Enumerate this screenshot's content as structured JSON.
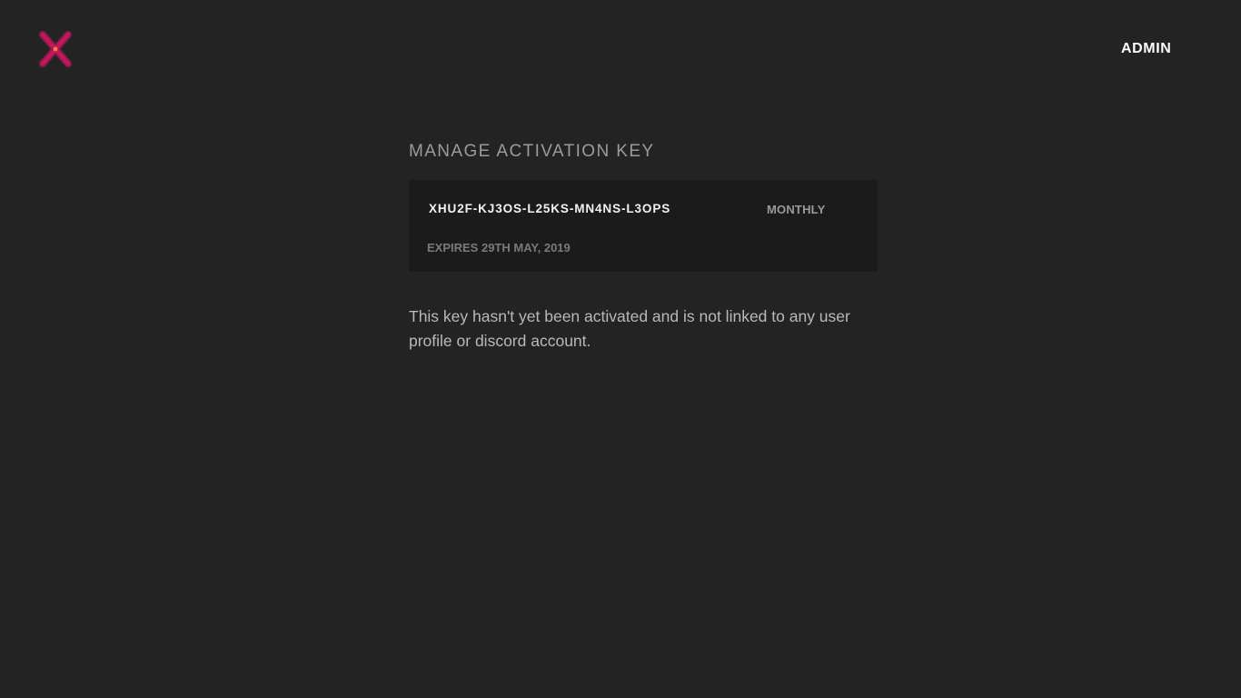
{
  "header": {
    "logo_icon": "x-logo-icon",
    "admin_label": "ADMIN"
  },
  "main": {
    "title": "MANAGE ACTIVATION KEY",
    "key": {
      "value": "XHU2F-KJ3OS-L25KS-MN4NS-L3OPS",
      "plan": "MONTHLY",
      "expires": "EXPIRES 29TH MAY, 2019"
    },
    "status_message": "This key hasn't yet been activated and is not linked to any user profile or discord account."
  },
  "colors": {
    "background": "#232323",
    "card_background": "#1b1b1b",
    "brand_accent": "#c2185b",
    "admin_text": "#ffffff"
  }
}
